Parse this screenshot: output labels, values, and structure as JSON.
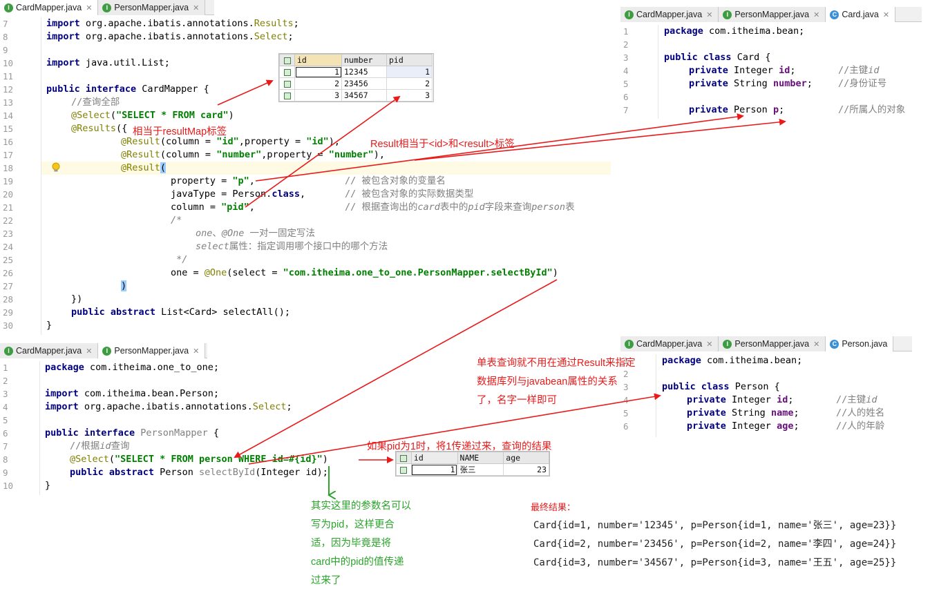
{
  "card_mapper_panel": {
    "tabs": [
      {
        "label": "CardMapper.java",
        "icon": "interface-file-icon",
        "active": true
      },
      {
        "label": "PersonMapper.java",
        "icon": "interface-file-icon",
        "active": false
      }
    ],
    "line_numbers": [
      "7",
      "8",
      "9",
      "10",
      "11",
      "12",
      "13",
      "14",
      "15",
      "16",
      "17",
      "18",
      "19",
      "20",
      "21",
      "22",
      "23",
      "24",
      "25",
      "26",
      "27",
      "28",
      "29",
      "30"
    ],
    "code": {
      "l7": {
        "kw": "import",
        "rest": " org.apache.ibatis.annotations.",
        "ann": "Results",
        "end": ";"
      },
      "l8": {
        "kw": "import",
        "rest": " org.apache.ibatis.annotations.",
        "ann": "Select",
        "end": ";"
      },
      "l10": {
        "kw": "import",
        "rest": " java.util.List;"
      },
      "l12": {
        "kw1": "public",
        "kw2": "interface",
        "rest": " CardMapper {"
      },
      "l13": {
        "comment": "//查询全部"
      },
      "l14": {
        "ann": "@Select",
        "open": "(",
        "str": "\"SELECT * FROM card\"",
        "close": ")"
      },
      "l15": {
        "ann": "@Results",
        "rest": "({"
      },
      "l16": {
        "ann": "@Result",
        "p1": "(column = ",
        "s1": "\"id\"",
        "p2": ",property = ",
        "s2": "\"id\"",
        "p3": "),"
      },
      "l17": {
        "ann": "@Result",
        "p1": "(column = ",
        "s1": "\"number\"",
        "p2": ",property = ",
        "s2": "\"number\"",
        "p3": "),"
      },
      "l18": {
        "ann": "@Result",
        "paren": "("
      },
      "l19": {
        "p1": "property = ",
        "s1": "\"p\"",
        "p2": ",",
        "comment": "// 被包含对象的变量名"
      },
      "l20": {
        "p1": "javaType = Person.",
        "kw": "class",
        "p2": ",",
        "comment": "// 被包含对象的实际数据类型"
      },
      "l21": {
        "p1": "column = ",
        "s1": "\"pid\"",
        "p2": ",",
        "comment_a": "// 根据查询出的",
        "comment_b": "card",
        "comment_c": "表中的",
        "comment_d": "pid",
        "comment_e": "字段来查询",
        "comment_f": "person",
        "comment_g": "表"
      },
      "l22": {
        "comment": "/*"
      },
      "l23": {
        "c1": "one",
        "c2": "、",
        "c3": "@One",
        "c4": " 一对一固定写法"
      },
      "l24": {
        "c1": "select",
        "c2": "属性：指定调用哪个接口中的哪个方法"
      },
      "l25": {
        "comment": " */"
      },
      "l26": {
        "p1": "one = ",
        "ann": "@One",
        "p2": "(select = ",
        "s1": "\"com.itheima.one_to_one.PersonMapper.selectById\"",
        "p3": ")"
      },
      "l27": {
        "paren": ")"
      },
      "l28": {
        "rest": "})"
      },
      "l29": {
        "kw1": "public",
        "kw2": "abstract",
        "rest": " List<Card> selectAll();"
      },
      "l30": {
        "rest": "}"
      }
    }
  },
  "card_table": {
    "columns": [
      "id",
      "number",
      "pid"
    ],
    "rows": [
      [
        "1",
        "12345",
        "1"
      ],
      [
        "2",
        "23456",
        "2"
      ],
      [
        "3",
        "34567",
        "3"
      ]
    ]
  },
  "card_java_panel": {
    "tabs": [
      {
        "label": "CardMapper.java",
        "icon": "interface-file-icon",
        "active": false
      },
      {
        "label": "PersonMapper.java",
        "icon": "interface-file-icon",
        "active": false
      },
      {
        "label": "Card.java",
        "icon": "class-file-icon",
        "active": true
      }
    ],
    "line_numbers": [
      "1",
      "2",
      "3",
      "4",
      "5",
      "6",
      "7"
    ],
    "code": {
      "l1": {
        "kw": "package",
        "rest": " com.itheima.bean;"
      },
      "l3": {
        "kw1": "public",
        "kw2": "class",
        "rest": " Card {"
      },
      "l4": {
        "kw": "private",
        "type": " Integer ",
        "field": "id",
        "end": ";",
        "comment_a": "//主键",
        "comment_b": "id"
      },
      "l5": {
        "kw": "private",
        "type": " String ",
        "field": "number",
        "end": ";",
        "comment_a": "//身份证号"
      },
      "l7": {
        "kw": "private",
        "type": " Person ",
        "field": "p",
        "end": ";",
        "comment_a": "//所属人的对象"
      }
    }
  },
  "person_mapper_panel": {
    "tabs": [
      {
        "label": "CardMapper.java",
        "icon": "interface-file-icon",
        "active": false
      },
      {
        "label": "PersonMapper.java",
        "icon": "interface-file-icon",
        "active": true
      }
    ],
    "line_numbers": [
      "1",
      "2",
      "3",
      "4",
      "5",
      "6",
      "7",
      "8",
      "9",
      "10"
    ],
    "code": {
      "l1": {
        "kw": "package",
        "rest": " com.itheima.one_to_one;"
      },
      "l3": {
        "kw": "import",
        "rest": " com.itheima.bean.Person;"
      },
      "l4": {
        "kw": "import",
        "rest": " org.apache.ibatis.annotations.",
        "ann": "Select",
        "end": ";"
      },
      "l6": {
        "kw1": "public",
        "kw2": "interface",
        "name": " PersonMapper",
        "rest": " {"
      },
      "l7": {
        "comment_a": "//根据",
        "comment_b": "id",
        "comment_c": "查询"
      },
      "l8": {
        "ann": "@Select",
        "open": "(",
        "str": "\"SELECT * FROM person WHERE id=#{id}\"",
        "close": ")"
      },
      "l9": {
        "kw1": "public",
        "kw2": "abstract",
        "p1": " Person ",
        "method": "selectById",
        "p2": "(Integer id);"
      },
      "l10": {
        "rest": "}"
      }
    }
  },
  "person_java_panel": {
    "tabs": [
      {
        "label": "CardMapper.java",
        "icon": "interface-file-icon",
        "active": false
      },
      {
        "label": "PersonMapper.java",
        "icon": "interface-file-icon",
        "active": false
      },
      {
        "label": "Person.java",
        "icon": "class-file-icon",
        "active": true
      }
    ],
    "line_numbers": [
      "1",
      "2",
      "3",
      "4",
      "5",
      "6"
    ],
    "code": {
      "l1": {
        "kw": "package",
        "rest": " com.itheima.bean;"
      },
      "l3": {
        "kw1": "public",
        "kw2": "class",
        "rest": " Person {"
      },
      "l4": {
        "kw": "private",
        "type": " Integer ",
        "field": "id",
        "end": ";",
        "comment_a": "//主键",
        "comment_b": "id"
      },
      "l5": {
        "kw": "private",
        "type": " String ",
        "field": "name",
        "end": ";",
        "comment_a": "//人的姓名"
      },
      "l6": {
        "kw": "private",
        "type": " Integer ",
        "field": "age",
        "end": ";",
        "comment_a": "//人的年龄"
      }
    }
  },
  "person_table": {
    "columns": [
      "id",
      "NAME",
      "age"
    ],
    "rows": [
      [
        "1",
        "张三",
        "23"
      ]
    ]
  },
  "annotations": {
    "result_map": "相当于resultMap标签",
    "result_tag": "Result相当于<id>和<result>标签",
    "single_table": [
      "单表查询就不用在通过Result来指定",
      "数据库列与javabean属性的关系",
      "了，名字一样即可"
    ],
    "pid_query": "如果pid为1时，将1传递过来，查询的结果",
    "param_name": [
      "其实这里的参数名可以",
      "写为pid，这样更合",
      "适，因为毕竟是将",
      "card中的pid的值传递",
      "过来了"
    ]
  },
  "final_result": {
    "title": "最终结果：",
    "lines": [
      "Card{id=1, number='12345', p=Person{id=1, name='张三', age=23}}",
      "Card{id=2, number='23456', p=Person{id=2, name='李四', age=24}}",
      "Card{id=3, number='34567', p=Person{id=3, name='王五', age=25}}"
    ]
  },
  "colors": {
    "keyword": "#000080",
    "annotation": "#808000",
    "string": "#008000",
    "comment": "#808080",
    "field": "#660e7a",
    "note_red": "#e81a1a",
    "note_green": "#2aa42a",
    "arrow_red": "#e81a1a",
    "arrow_green": "#2aa42a"
  }
}
